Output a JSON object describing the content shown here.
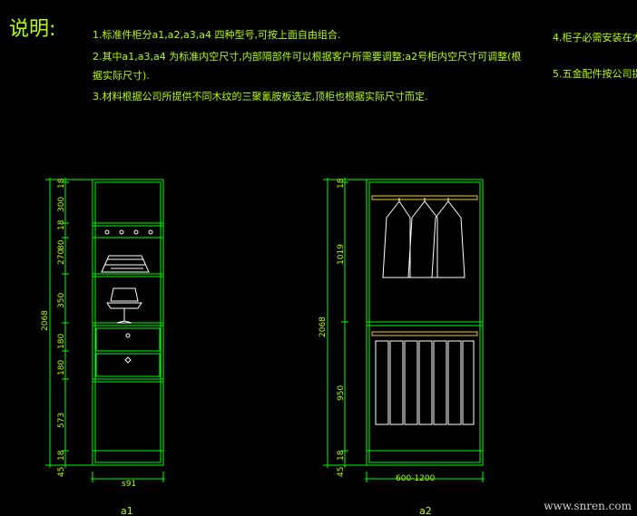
{
  "heading": "说明:",
  "notes": {
    "n1": "1.标准件柜分a1,a2,a3,a4 四种型号,可按上面自由组合.",
    "n2a": "2.其中a1,a3,a4 为标准内空尺寸,内部隔部件可以根据客户所需要调整;a2号柜内空尺寸可调整(根",
    "n2b": "据实际尺寸).",
    "n3": "3.材料根据公司所提供不同木纹的三聚氰胺板选定,顶柜也根据实际尺寸而定.",
    "n4": "4.柜子必需安装在木",
    "n5": "5.五金配件按公司提供"
  },
  "cabinet_a1": {
    "label": "a1",
    "total_height": "2068",
    "width": "s91",
    "dims": [
      "18",
      "300",
      "18",
      "80",
      "270",
      "350",
      "180",
      "180",
      "573",
      "18",
      "45",
      "18"
    ]
  },
  "cabinet_a2": {
    "label": "a2",
    "total_height": "2068",
    "width": "600-1200",
    "dims": [
      "18",
      "1019",
      "950",
      "18",
      "45",
      "18"
    ]
  },
  "watermark": "www.snren.com",
  "colors": {
    "line": "#00ff00",
    "text": "#b7ff00",
    "rod": "#ffcc00",
    "item": "#ffffff"
  }
}
